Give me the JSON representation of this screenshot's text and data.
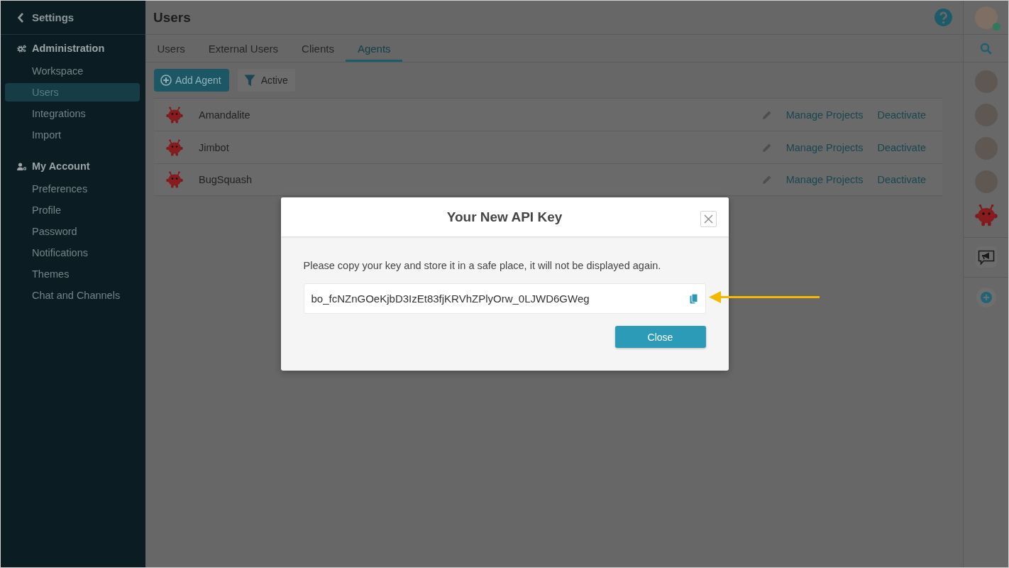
{
  "sidebar": {
    "back_label": "Settings",
    "sections": [
      {
        "kind": "admin",
        "title": "Administration",
        "items": [
          {
            "label": "Workspace",
            "selected": false
          },
          {
            "label": "Users",
            "selected": true
          },
          {
            "label": "Integrations",
            "selected": false
          },
          {
            "label": "Import",
            "selected": false
          }
        ]
      },
      {
        "kind": "account",
        "title": "My Account",
        "items": [
          {
            "label": "Preferences",
            "selected": false
          },
          {
            "label": "Profile",
            "selected": false
          },
          {
            "label": "Password",
            "selected": false
          },
          {
            "label": "Notifications",
            "selected": false
          },
          {
            "label": "Themes",
            "selected": false
          },
          {
            "label": "Chat and Channels",
            "selected": false
          }
        ]
      }
    ]
  },
  "header": {
    "title": "Users"
  },
  "tabs": [
    {
      "label": "Users",
      "selected": false
    },
    {
      "label": "External Users",
      "selected": false
    },
    {
      "label": "Clients",
      "selected": false
    },
    {
      "label": "Agents",
      "selected": true
    }
  ],
  "toolbar": {
    "add_button": "Add Agent",
    "filter_button": "Active"
  },
  "agents": [
    {
      "name": "Amandalite",
      "manage_link": "Manage Projects",
      "deactivate_link": "Deactivate"
    },
    {
      "name": "Jimbot",
      "manage_link": "Manage Projects",
      "deactivate_link": "Deactivate"
    },
    {
      "name": "BugSquash",
      "manage_link": "Manage Projects",
      "deactivate_link": "Deactivate"
    }
  ],
  "right_rail": {
    "profile": {
      "online": true
    },
    "members": [
      {
        "kind": "photo"
      },
      {
        "kind": "photo"
      },
      {
        "kind": "photo"
      },
      {
        "kind": "photo"
      },
      {
        "kind": "agent"
      }
    ]
  },
  "modal": {
    "title": "Your New API Key",
    "message": "Please copy your key and store it in a safe place, it will not be displayed again.",
    "api_key": "bo_fcNZnGOeKjbD3IzEt83fjKRVhZPlyOrw_0LJWD6GWeg",
    "close_button": "Close"
  }
}
